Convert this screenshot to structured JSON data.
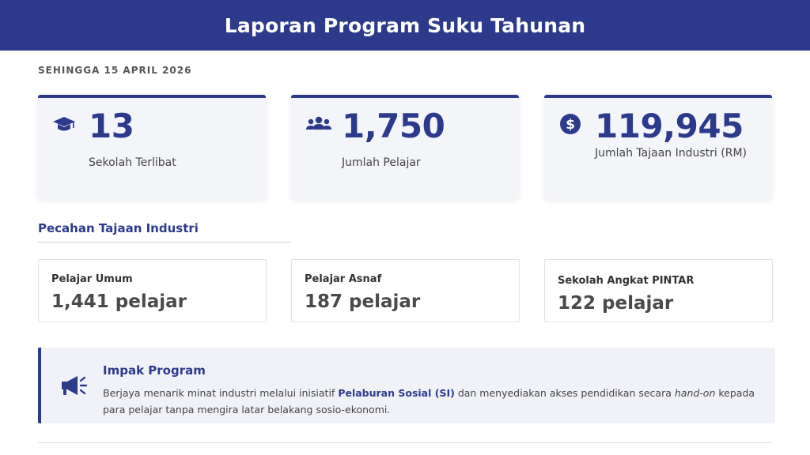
{
  "header": {
    "title": "Laporan Program Suku Tahunan"
  },
  "date_line": "SEHINGGA 15 APRIL 2026",
  "stats": [
    {
      "icon": "graduation-cap-icon",
      "value": "13",
      "label": "Sekolah Terlibat"
    },
    {
      "icon": "users-group-icon",
      "value": "1,750",
      "label": "Jumlah Pelajar"
    },
    {
      "icon": "dollar-circle-icon",
      "value": "119,945",
      "label": "Jumlah Tajaan Industri (RM)"
    }
  ],
  "section_title": "Pecahan Tajaan Industri",
  "breakdown": [
    {
      "label": "Pelajar Umum",
      "value": "1,441 pelajar"
    },
    {
      "label": "Pelajar Asnaf",
      "value": "187 pelajar"
    },
    {
      "label": "Sekolah Angkat PINTAR",
      "value": "122 pelajar"
    }
  ],
  "impact": {
    "icon": "megaphone-icon",
    "title": "Impak Program",
    "text_part1": "Berjaya menarik minat industri melalui inisiatif ",
    "text_bold": "Pelaburan Sosial (SI)",
    "text_part2": " dan menyediakan akses pendidikan secara ",
    "text_italic": "hand-on",
    "text_part3": " kepada para pelajar tanpa mengira latar belakang sosio-ekonomi."
  },
  "colors": {
    "primary": "#2d3a8c",
    "card_bg": "#f4f5f9"
  }
}
